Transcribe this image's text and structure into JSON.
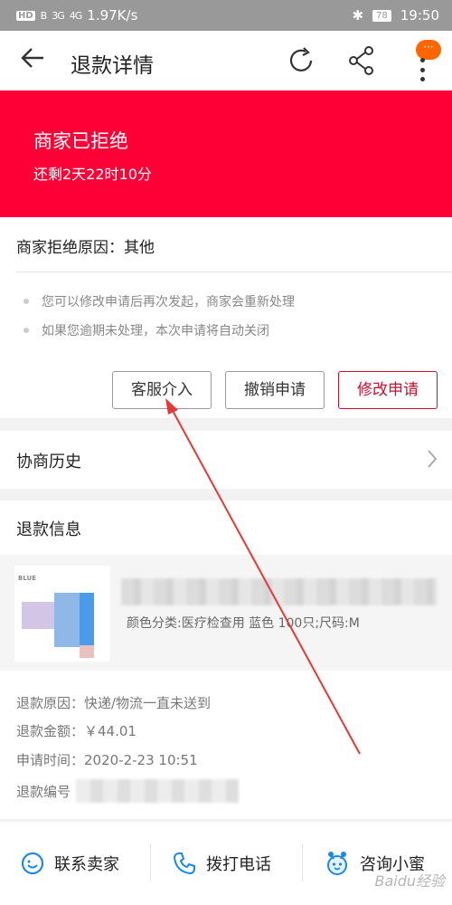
{
  "status_bar": {
    "hd": "HD",
    "network": "B",
    "signal1": "3G",
    "signal2": "4G",
    "speed": "1.97K/s",
    "battery": "78",
    "time": "19:50"
  },
  "header": {
    "title": "退款详情",
    "more_badge": "···"
  },
  "banner": {
    "status": "商家已拒绝",
    "remaining": "还剩2天22时10分"
  },
  "reason": {
    "text": "商家拒绝原因：其他",
    "tips": [
      "您可以修改申请后再次发起，商家会重新处理",
      "如果您逾期未处理，本次申请将自动关闭"
    ],
    "buttons": {
      "kefu": "客服介入",
      "cancel": "撤销申请",
      "modify": "修改申请"
    }
  },
  "history": {
    "label": "协商历史"
  },
  "refund_info": {
    "title": "退款信息",
    "product": {
      "thumb_brand": "BLUE",
      "spec": "颜色分类:医疗检查用 蓝色 100只;尺码:M"
    },
    "rows": {
      "reason": "退款原因：快递/物流一直未送到",
      "amount": "退款金额：￥44.01",
      "time": "申请时间：2020-2-23 10:51",
      "number_label": "退款编号"
    }
  },
  "bottom_bar": {
    "contact": "联系卖家",
    "call": "拨打电话",
    "ask": "咨询小蜜"
  },
  "watermark": "Baidu经验",
  "colors": {
    "banner": "#ff0036",
    "accent": "#c8102e",
    "annotation_arrow": "#e53935",
    "icon_blue": "#1e88e5"
  }
}
